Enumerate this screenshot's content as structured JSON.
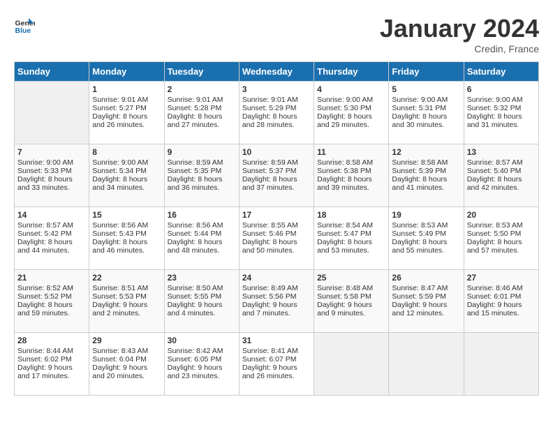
{
  "header": {
    "logo": {
      "general": "General",
      "blue": "Blue"
    },
    "title": "January 2024",
    "subtitle": "Credin, France"
  },
  "calendar": {
    "weekdays": [
      "Sunday",
      "Monday",
      "Tuesday",
      "Wednesday",
      "Thursday",
      "Friday",
      "Saturday"
    ],
    "weeks": [
      [
        {
          "day": "",
          "content": ""
        },
        {
          "day": "1",
          "content": "Sunrise: 9:01 AM\nSunset: 5:27 PM\nDaylight: 8 hours\nand 26 minutes."
        },
        {
          "day": "2",
          "content": "Sunrise: 9:01 AM\nSunset: 5:28 PM\nDaylight: 8 hours\nand 27 minutes."
        },
        {
          "day": "3",
          "content": "Sunrise: 9:01 AM\nSunset: 5:29 PM\nDaylight: 8 hours\nand 28 minutes."
        },
        {
          "day": "4",
          "content": "Sunrise: 9:00 AM\nSunset: 5:30 PM\nDaylight: 8 hours\nand 29 minutes."
        },
        {
          "day": "5",
          "content": "Sunrise: 9:00 AM\nSunset: 5:31 PM\nDaylight: 8 hours\nand 30 minutes."
        },
        {
          "day": "6",
          "content": "Sunrise: 9:00 AM\nSunset: 5:32 PM\nDaylight: 8 hours\nand 31 minutes."
        }
      ],
      [
        {
          "day": "7",
          "content": "Sunrise: 9:00 AM\nSunset: 5:33 PM\nDaylight: 8 hours\nand 33 minutes."
        },
        {
          "day": "8",
          "content": "Sunrise: 9:00 AM\nSunset: 5:34 PM\nDaylight: 8 hours\nand 34 minutes."
        },
        {
          "day": "9",
          "content": "Sunrise: 8:59 AM\nSunset: 5:35 PM\nDaylight: 8 hours\nand 36 minutes."
        },
        {
          "day": "10",
          "content": "Sunrise: 8:59 AM\nSunset: 5:37 PM\nDaylight: 8 hours\nand 37 minutes."
        },
        {
          "day": "11",
          "content": "Sunrise: 8:58 AM\nSunset: 5:38 PM\nDaylight: 8 hours\nand 39 minutes."
        },
        {
          "day": "12",
          "content": "Sunrise: 8:58 AM\nSunset: 5:39 PM\nDaylight: 8 hours\nand 41 minutes."
        },
        {
          "day": "13",
          "content": "Sunrise: 8:57 AM\nSunset: 5:40 PM\nDaylight: 8 hours\nand 42 minutes."
        }
      ],
      [
        {
          "day": "14",
          "content": "Sunrise: 8:57 AM\nSunset: 5:42 PM\nDaylight: 8 hours\nand 44 minutes."
        },
        {
          "day": "15",
          "content": "Sunrise: 8:56 AM\nSunset: 5:43 PM\nDaylight: 8 hours\nand 46 minutes."
        },
        {
          "day": "16",
          "content": "Sunrise: 8:56 AM\nSunset: 5:44 PM\nDaylight: 8 hours\nand 48 minutes."
        },
        {
          "day": "17",
          "content": "Sunrise: 8:55 AM\nSunset: 5:46 PM\nDaylight: 8 hours\nand 50 minutes."
        },
        {
          "day": "18",
          "content": "Sunrise: 8:54 AM\nSunset: 5:47 PM\nDaylight: 8 hours\nand 53 minutes."
        },
        {
          "day": "19",
          "content": "Sunrise: 8:53 AM\nSunset: 5:49 PM\nDaylight: 8 hours\nand 55 minutes."
        },
        {
          "day": "20",
          "content": "Sunrise: 8:53 AM\nSunset: 5:50 PM\nDaylight: 8 hours\nand 57 minutes."
        }
      ],
      [
        {
          "day": "21",
          "content": "Sunrise: 8:52 AM\nSunset: 5:52 PM\nDaylight: 8 hours\nand 59 minutes."
        },
        {
          "day": "22",
          "content": "Sunrise: 8:51 AM\nSunset: 5:53 PM\nDaylight: 9 hours\nand 2 minutes."
        },
        {
          "day": "23",
          "content": "Sunrise: 8:50 AM\nSunset: 5:55 PM\nDaylight: 9 hours\nand 4 minutes."
        },
        {
          "day": "24",
          "content": "Sunrise: 8:49 AM\nSunset: 5:56 PM\nDaylight: 9 hours\nand 7 minutes."
        },
        {
          "day": "25",
          "content": "Sunrise: 8:48 AM\nSunset: 5:58 PM\nDaylight: 9 hours\nand 9 minutes."
        },
        {
          "day": "26",
          "content": "Sunrise: 8:47 AM\nSunset: 5:59 PM\nDaylight: 9 hours\nand 12 minutes."
        },
        {
          "day": "27",
          "content": "Sunrise: 8:46 AM\nSunset: 6:01 PM\nDaylight: 9 hours\nand 15 minutes."
        }
      ],
      [
        {
          "day": "28",
          "content": "Sunrise: 8:44 AM\nSunset: 6:02 PM\nDaylight: 9 hours\nand 17 minutes."
        },
        {
          "day": "29",
          "content": "Sunrise: 8:43 AM\nSunset: 6:04 PM\nDaylight: 9 hours\nand 20 minutes."
        },
        {
          "day": "30",
          "content": "Sunrise: 8:42 AM\nSunset: 6:05 PM\nDaylight: 9 hours\nand 23 minutes."
        },
        {
          "day": "31",
          "content": "Sunrise: 8:41 AM\nSunset: 6:07 PM\nDaylight: 9 hours\nand 26 minutes."
        },
        {
          "day": "",
          "content": ""
        },
        {
          "day": "",
          "content": ""
        },
        {
          "day": "",
          "content": ""
        }
      ]
    ]
  }
}
